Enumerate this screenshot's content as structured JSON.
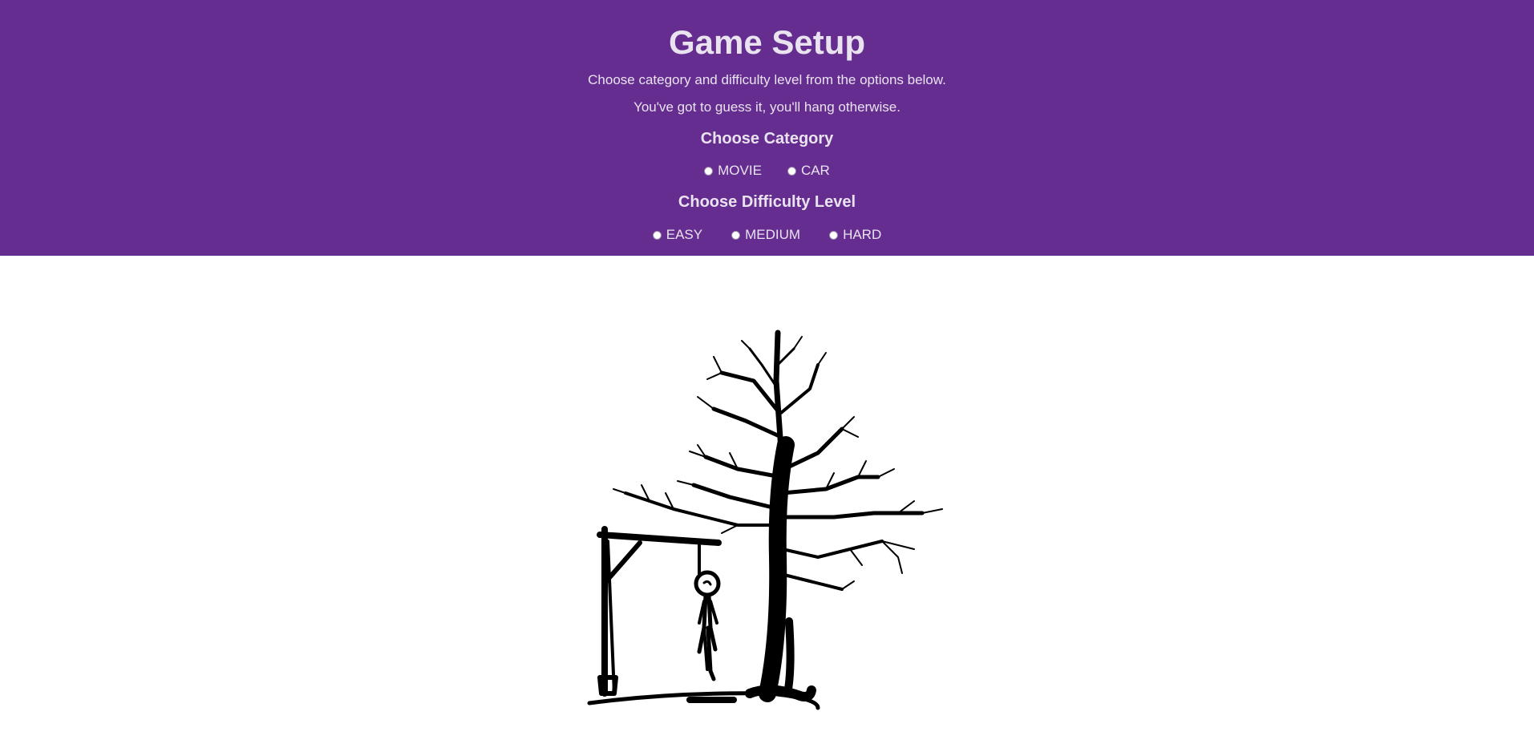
{
  "header": {
    "title": "Game Setup",
    "line1": "Choose category and difficulty level from the options below.",
    "line2": "You've got to guess it, you'll hang otherwise.",
    "bg_color": "#652d90"
  },
  "category": {
    "heading": "Choose Category",
    "options": [
      "MOVIE",
      "CAR"
    ]
  },
  "difficulty": {
    "heading": "Choose Difficulty Level",
    "options": [
      "EASY",
      "MEDIUM",
      "HARD"
    ]
  },
  "illustration": {
    "icon": "hangman-tree-icon"
  }
}
